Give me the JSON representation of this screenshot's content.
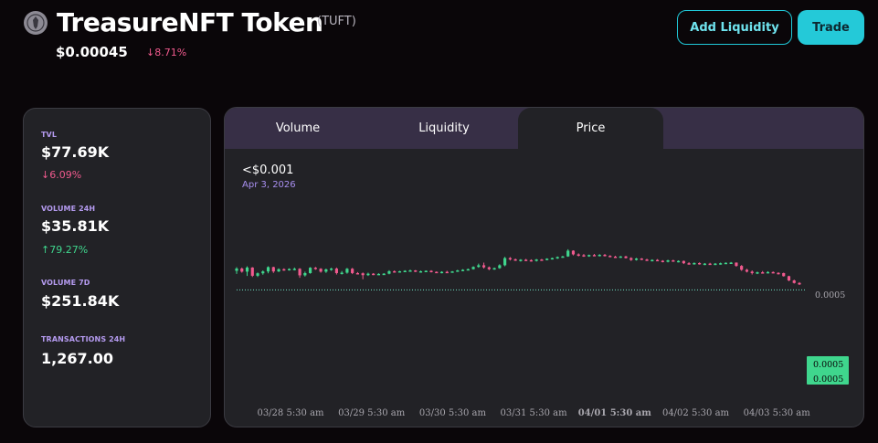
{
  "header": {
    "token_name": "TreasureNFT Token",
    "token_symbol": "(TUFT)",
    "price": "$0.00045",
    "change": "↓8.71%",
    "logo_icon": "treasure-nft-logo-icon"
  },
  "actions": {
    "add_liquidity_label": "Add Liquidity",
    "trade_label": "Trade"
  },
  "stats": {
    "tvl_label": "TVL",
    "tvl_value": "$77.69K",
    "tvl_change": "↓6.09%",
    "volume24_label": "VOLUME 24H",
    "volume24_value": "$35.81K",
    "volume24_change": "↑79.27%",
    "volume7_label": "VOLUME 7D",
    "volume7_value": "$251.84K",
    "tx24_label": "TRANSACTIONS 24H",
    "tx24_value": "1,267.00"
  },
  "tabs": [
    {
      "label": "Volume",
      "active": false
    },
    {
      "label": "Liquidity",
      "active": false
    },
    {
      "label": "Price",
      "active": true
    }
  ],
  "hover": {
    "price": "<$0.001",
    "date": "Apr 3, 2026"
  },
  "colors": {
    "up": "#3fd68d",
    "down": "#f15a8e",
    "accent": "#24c9d8",
    "label_purple": "#b59bf0"
  },
  "chart_data": {
    "type": "candlestick",
    "price_scale_labels": [
      "0.0005",
      "0.0005",
      "0.0005"
    ],
    "x_tick_labels": [
      "03/28 5:30 am",
      "03/29 5:30 am",
      "03/30 5:30 am",
      "03/31 5:30 am",
      "04/01 5:30 am",
      "04/02 5:30 am",
      "04/03 5:30 am"
    ],
    "bold_tick": "04/01 5:30 am",
    "y_domain": [
      0.000455,
      0.000535
    ],
    "current_price_line": true,
    "candles": [
      [
        0.000509,
        0.0005108,
        0.0005075,
        0.0005101
      ],
      [
        0.0005101,
        0.0005106,
        0.0005081,
        0.0005086
      ],
      [
        0.0005086,
        0.0005112,
        0.0005065,
        0.0005106
      ],
      [
        0.0005106,
        0.0005108,
        0.000506,
        0.0005066
      ],
      [
        0.0005066,
        0.0005082,
        0.000506,
        0.0005078
      ],
      [
        0.0005078,
        0.0005092,
        0.0005071,
        0.0005087
      ],
      [
        0.0005087,
        0.0005112,
        0.0005078,
        0.0005108
      ],
      [
        0.0005108,
        0.000511,
        0.000508,
        0.0005087
      ],
      [
        0.0005087,
        0.0005102,
        0.0005084,
        0.0005098
      ],
      [
        0.0005098,
        0.0005102,
        0.000509,
        0.0005095
      ],
      [
        0.0005095,
        0.0005102,
        0.0005091,
        0.0005099
      ],
      [
        0.0005099,
        0.0005106,
        0.0005092,
        0.00051
      ],
      [
        0.00051,
        0.0005103,
        0.0005056,
        0.0005068
      ],
      [
        0.0005068,
        0.0005086,
        0.0005062,
        0.0005079
      ],
      [
        0.0005079,
        0.0005108,
        0.0005076,
        0.0005105
      ],
      [
        0.0005105,
        0.0005109,
        0.0005095,
        0.00051
      ],
      [
        0.00051,
        0.0005103,
        0.0005081,
        0.0005086
      ],
      [
        0.0005086,
        0.0005101,
        0.000508,
        0.0005097
      ],
      [
        0.0005097,
        0.0005105,
        0.000509,
        0.0005101
      ],
      [
        0.0005101,
        0.0005106,
        0.0005072,
        0.0005079
      ],
      [
        0.0005079,
        0.0005089,
        0.0005072,
        0.0005081
      ],
      [
        0.0005081,
        0.0005104,
        0.0005076,
        0.00051
      ],
      [
        0.00051,
        0.0005104,
        0.0005074,
        0.0005079
      ],
      [
        0.0005079,
        0.0005084,
        0.0005073,
        0.0005078
      ],
      [
        0.0005078,
        0.0005082,
        0.0005049,
        0.0005069
      ],
      [
        0.0005069,
        0.0005081,
        0.0005065,
        0.0005076
      ],
      [
        0.0005076,
        0.0005079,
        0.0005069,
        0.0005073
      ],
      [
        0.0005073,
        0.0005078,
        0.0005071,
        0.0005075
      ],
      [
        0.0005075,
        0.0005079,
        0.0005073,
        0.0005076
      ],
      [
        0.0005076,
        0.0005093,
        0.0005073,
        0.0005088
      ],
      [
        0.0005088,
        0.0005092,
        0.0005081,
        0.0005085
      ],
      [
        0.0005085,
        0.000509,
        0.0005082,
        0.0005088
      ],
      [
        0.0005088,
        0.0005093,
        0.0005085,
        0.000509
      ],
      [
        0.000509,
        0.0005096,
        0.0005087,
        0.0005092
      ],
      [
        0.0005092,
        0.0005094,
        0.0005084,
        0.0005086
      ],
      [
        0.0005086,
        0.0005091,
        0.0005081,
        0.0005088
      ],
      [
        0.0005088,
        0.0005092,
        0.0005084,
        0.000509
      ],
      [
        0.000509,
        0.0005093,
        0.0005082,
        0.0005085
      ],
      [
        0.0005085,
        0.0005087,
        0.0005079,
        0.0005082
      ],
      [
        0.0005082,
        0.0005088,
        0.0005078,
        0.0005085
      ],
      [
        0.0005085,
        0.000509,
        0.000508,
        0.0005084
      ],
      [
        0.0005084,
        0.0005089,
        0.0005081,
        0.0005087
      ],
      [
        0.0005087,
        0.0005095,
        0.0005085,
        0.0005092
      ],
      [
        0.0005092,
        0.0005098,
        0.0005088,
        0.0005095
      ],
      [
        0.0005095,
        0.0005101,
        0.0005092,
        0.0005098
      ],
      [
        0.0005098,
        0.0005112,
        0.0005096,
        0.0005109
      ],
      [
        0.0005109,
        0.0005125,
        0.0005105,
        0.0005117
      ],
      [
        0.0005117,
        0.000513,
        0.0005101,
        0.0005107
      ],
      [
        0.0005107,
        0.0005111,
        0.0005093,
        0.0005098
      ],
      [
        0.0005098,
        0.0005106,
        0.0005095,
        0.0005103
      ],
      [
        0.0005103,
        0.0005122,
        0.00051,
        0.0005117
      ],
      [
        0.0005117,
        0.0005158,
        0.0005112,
        0.0005152
      ],
      [
        0.0005152,
        0.0005157,
        0.000514,
        0.0005146
      ],
      [
        0.0005146,
        0.000515,
        0.0005138,
        0.0005141
      ],
      [
        0.0005141,
        0.0005147,
        0.0005135,
        0.0005144
      ],
      [
        0.0005144,
        0.0005148,
        0.0005138,
        0.0005142
      ],
      [
        0.0005142,
        0.0005146,
        0.0005135,
        0.0005139
      ],
      [
        0.0005139,
        0.0005148,
        0.0005135,
        0.0005145
      ],
      [
        0.0005145,
        0.0005148,
        0.000514,
        0.0005143
      ],
      [
        0.0005143,
        0.0005151,
        0.0005141,
        0.0005149
      ],
      [
        0.0005149,
        0.0005154,
        0.0005145,
        0.0005152
      ],
      [
        0.0005152,
        0.000516,
        0.0005148,
        0.0005157
      ],
      [
        0.0005157,
        0.0005163,
        0.0005154,
        0.000516
      ],
      [
        0.000516,
        0.0005195,
        0.0005158,
        0.0005188
      ],
      [
        0.0005188,
        0.000519,
        0.0005165,
        0.000517
      ],
      [
        0.000517,
        0.0005175,
        0.000516,
        0.0005166
      ],
      [
        0.0005166,
        0.0005172,
        0.0005158,
        0.0005161
      ],
      [
        0.0005161,
        0.0005169,
        0.0005158,
        0.0005167
      ],
      [
        0.0005167,
        0.0005172,
        0.0005162,
        0.0005165
      ],
      [
        0.0005165,
        0.0005171,
        0.000516,
        0.0005168
      ],
      [
        0.0005168,
        0.0005172,
        0.000516,
        0.0005163
      ],
      [
        0.0005163,
        0.0005166,
        0.0005156,
        0.0005159
      ],
      [
        0.0005159,
        0.0005163,
        0.0005154,
        0.0005157
      ],
      [
        0.0005157,
        0.0005162,
        0.0005153,
        0.000516
      ],
      [
        0.000516,
        0.0005163,
        0.000515,
        0.0005152
      ],
      [
        0.0005152,
        0.0005156,
        0.0005138,
        0.0005143
      ],
      [
        0.0005143,
        0.0005153,
        0.000514,
        0.000515
      ],
      [
        0.000515,
        0.0005152,
        0.0005142,
        0.0005145
      ],
      [
        0.0005145,
        0.0005149,
        0.0005138,
        0.000514
      ],
      [
        0.000514,
        0.0005146,
        0.0005136,
        0.0005143
      ],
      [
        0.0005143,
        0.0005147,
        0.0005137,
        0.0005139
      ],
      [
        0.0005139,
        0.0005142,
        0.0005131,
        0.0005134
      ],
      [
        0.0005134,
        0.0005144,
        0.0005131,
        0.0005141
      ],
      [
        0.0005141,
        0.0005144,
        0.0005134,
        0.0005136
      ],
      [
        0.0005136,
        0.0005141,
        0.0005131,
        0.0005138
      ],
      [
        0.0005138,
        0.000514,
        0.0005123,
        0.0005127
      ],
      [
        0.0005127,
        0.0005132,
        0.000512,
        0.0005124
      ],
      [
        0.0005124,
        0.0005131,
        0.000512,
        0.0005128
      ],
      [
        0.0005128,
        0.0005131,
        0.000512,
        0.0005123
      ],
      [
        0.0005123,
        0.0005128,
        0.0005118,
        0.0005125
      ],
      [
        0.0005125,
        0.0005129,
        0.0005119,
        0.0005121
      ],
      [
        0.0005121,
        0.0005128,
        0.0005118,
        0.0005125
      ],
      [
        0.0005125,
        0.000513,
        0.000512,
        0.0005127
      ],
      [
        0.0005127,
        0.0005131,
        0.0005124,
        0.0005129
      ],
      [
        0.0005129,
        0.0005133,
        0.0005125,
        0.000513
      ],
      [
        0.000513,
        0.0005131,
        0.000511,
        0.0005114
      ],
      [
        0.0005114,
        0.0005118,
        0.000509,
        0.0005095
      ],
      [
        0.0005095,
        0.00051,
        0.0005082,
        0.0005086
      ],
      [
        0.0005086,
        0.0005092,
        0.0005072,
        0.0005079
      ],
      [
        0.0005079,
        0.0005086,
        0.0005074,
        0.0005083
      ],
      [
        0.0005083,
        0.0005089,
        0.0005079,
        0.0005082
      ],
      [
        0.0005082,
        0.0005088,
        0.0005078,
        0.0005084
      ],
      [
        0.0005084,
        0.0005087,
        0.0005078,
        0.000508
      ],
      [
        0.000508,
        0.0005083,
        0.0005072,
        0.0005079
      ],
      [
        0.0005079,
        0.0005081,
        0.0005062,
        0.0005064
      ],
      [
        0.0005064,
        0.0005066,
        0.000504,
        0.0005043
      ],
      [
        0.0005043,
        0.0005047,
        0.0005028,
        0.0005031
      ],
      [
        0.0005031,
        0.0005035,
        0.0005021,
        0.0005024
      ]
    ]
  }
}
